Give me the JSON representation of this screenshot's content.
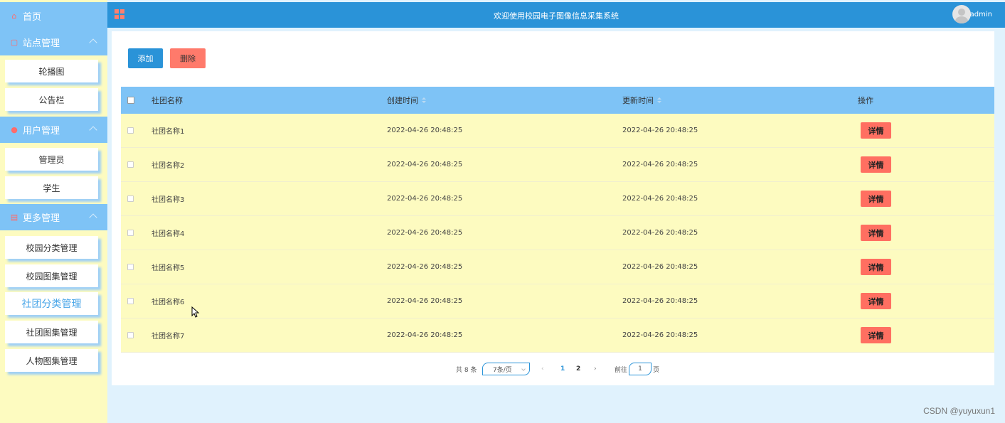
{
  "sidebar": {
    "home_label": "首页",
    "groups": [
      {
        "label": "站点管理",
        "items": [
          "轮播图",
          "公告栏"
        ]
      },
      {
        "label": "用户管理",
        "items": [
          "管理员",
          "学生"
        ]
      },
      {
        "label": "更多管理",
        "items": [
          "校园分类管理",
          "校园图集管理",
          "社团分类管理",
          "社团图集管理",
          "人物图集管理"
        ]
      }
    ],
    "active_item": "社团分类管理"
  },
  "header": {
    "title": "欢迎使用校园电子图像信息采集系统",
    "user": "admin"
  },
  "toolbar": {
    "add_label": "添加",
    "delete_label": "删除"
  },
  "table": {
    "columns": [
      "社团名称",
      "创建时间",
      "更新时间",
      "操作"
    ],
    "rows": [
      {
        "name": "社团名称1",
        "created": "2022-04-26 20:48:25",
        "updated": "2022-04-26 20:48:25",
        "action": "详情"
      },
      {
        "name": "社团名称2",
        "created": "2022-04-26 20:48:25",
        "updated": "2022-04-26 20:48:25",
        "action": "详情"
      },
      {
        "name": "社团名称3",
        "created": "2022-04-26 20:48:25",
        "updated": "2022-04-26 20:48:25",
        "action": "详情"
      },
      {
        "name": "社团名称4",
        "created": "2022-04-26 20:48:25",
        "updated": "2022-04-26 20:48:25",
        "action": "详情"
      },
      {
        "name": "社团名称5",
        "created": "2022-04-26 20:48:25",
        "updated": "2022-04-26 20:48:25",
        "action": "详情"
      },
      {
        "name": "社团名称6",
        "created": "2022-04-26 20:48:25",
        "updated": "2022-04-26 20:48:25",
        "action": "详情"
      },
      {
        "name": "社团名称7",
        "created": "2022-04-26 20:48:25",
        "updated": "2022-04-26 20:48:25",
        "action": "详情"
      }
    ]
  },
  "pagination": {
    "total_text": "共 8 条",
    "page_size": "7条/页",
    "pages": [
      "1",
      "2"
    ],
    "current_page": "1",
    "goto_label": "前往",
    "goto_value": "1",
    "page_suffix": "页"
  },
  "watermark": "CSDN @yuyuxun1",
  "colors": {
    "sidebar_bg": "#fdfbc0",
    "sidebar_head": "#7ec3f6",
    "topbar": "#2a93d8",
    "accent_red": "#ff6f61",
    "row_bg": "#fdfbc0",
    "page_bg": "#e0f2fd"
  }
}
